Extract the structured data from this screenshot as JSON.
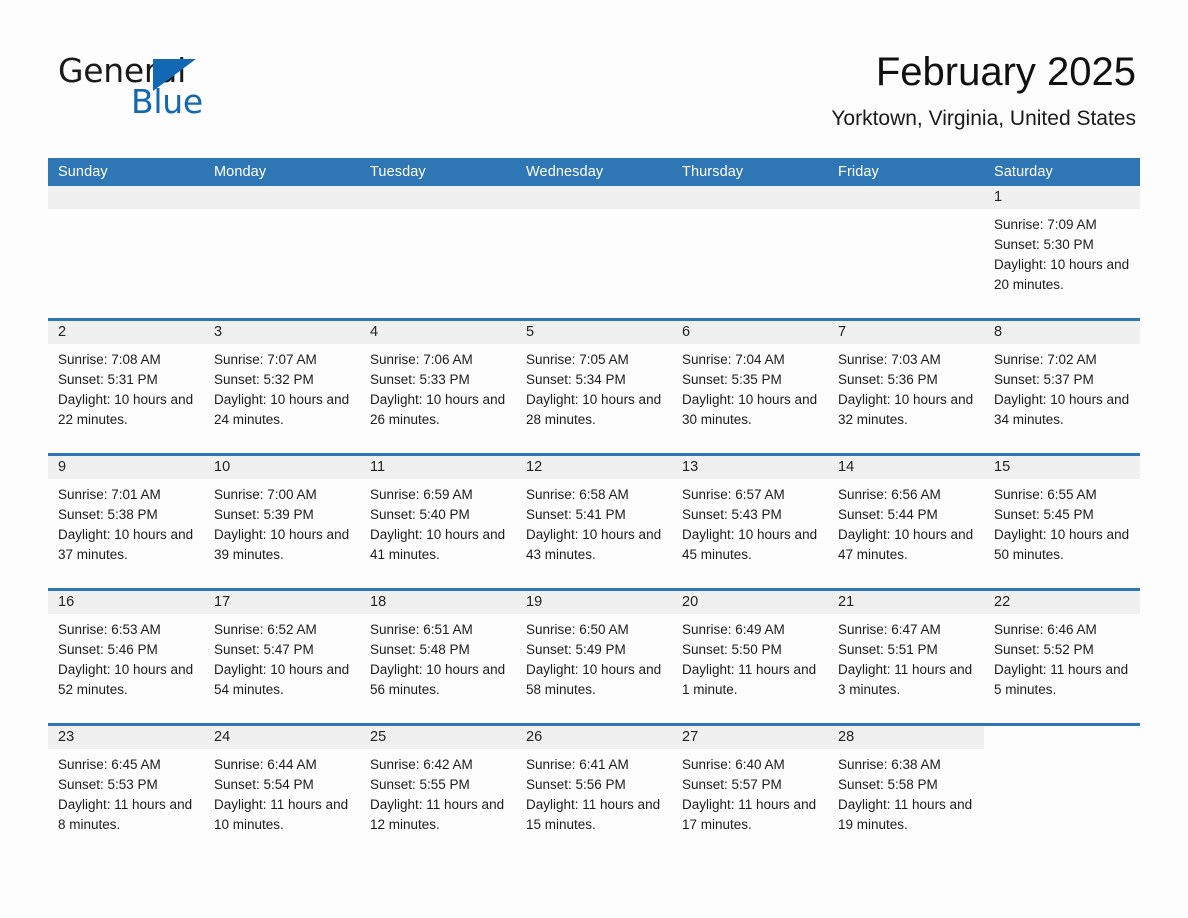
{
  "brand": {
    "name_part1": "General",
    "name_part2": "Blue",
    "accent_color": "#1268b3"
  },
  "header": {
    "title": "February 2025",
    "subtitle": "Yorktown, Virginia, United States"
  },
  "theme": {
    "header_bar_color": "#2f76b4",
    "daynum_band_color": "#f0f0f0",
    "page_background": "#fdfdfd",
    "text_color": "#1c1c1c"
  },
  "weekdays": [
    "Sunday",
    "Monday",
    "Tuesday",
    "Wednesday",
    "Thursday",
    "Friday",
    "Saturday"
  ],
  "weeks": [
    [
      {
        "blank": true
      },
      {
        "blank": true
      },
      {
        "blank": true
      },
      {
        "blank": true
      },
      {
        "blank": true
      },
      {
        "blank": true
      },
      {
        "day": "1",
        "sunrise": "Sunrise: 7:09 AM",
        "sunset": "Sunset: 5:30 PM",
        "daylight": "Daylight: 10 hours and 20 minutes."
      }
    ],
    [
      {
        "day": "2",
        "sunrise": "Sunrise: 7:08 AM",
        "sunset": "Sunset: 5:31 PM",
        "daylight": "Daylight: 10 hours and 22 minutes."
      },
      {
        "day": "3",
        "sunrise": "Sunrise: 7:07 AM",
        "sunset": "Sunset: 5:32 PM",
        "daylight": "Daylight: 10 hours and 24 minutes."
      },
      {
        "day": "4",
        "sunrise": "Sunrise: 7:06 AM",
        "sunset": "Sunset: 5:33 PM",
        "daylight": "Daylight: 10 hours and 26 minutes."
      },
      {
        "day": "5",
        "sunrise": "Sunrise: 7:05 AM",
        "sunset": "Sunset: 5:34 PM",
        "daylight": "Daylight: 10 hours and 28 minutes."
      },
      {
        "day": "6",
        "sunrise": "Sunrise: 7:04 AM",
        "sunset": "Sunset: 5:35 PM",
        "daylight": "Daylight: 10 hours and 30 minutes."
      },
      {
        "day": "7",
        "sunrise": "Sunrise: 7:03 AM",
        "sunset": "Sunset: 5:36 PM",
        "daylight": "Daylight: 10 hours and 32 minutes."
      },
      {
        "day": "8",
        "sunrise": "Sunrise: 7:02 AM",
        "sunset": "Sunset: 5:37 PM",
        "daylight": "Daylight: 10 hours and 34 minutes."
      }
    ],
    [
      {
        "day": "9",
        "sunrise": "Sunrise: 7:01 AM",
        "sunset": "Sunset: 5:38 PM",
        "daylight": "Daylight: 10 hours and 37 minutes."
      },
      {
        "day": "10",
        "sunrise": "Sunrise: 7:00 AM",
        "sunset": "Sunset: 5:39 PM",
        "daylight": "Daylight: 10 hours and 39 minutes."
      },
      {
        "day": "11",
        "sunrise": "Sunrise: 6:59 AM",
        "sunset": "Sunset: 5:40 PM",
        "daylight": "Daylight: 10 hours and 41 minutes."
      },
      {
        "day": "12",
        "sunrise": "Sunrise: 6:58 AM",
        "sunset": "Sunset: 5:41 PM",
        "daylight": "Daylight: 10 hours and 43 minutes."
      },
      {
        "day": "13",
        "sunrise": "Sunrise: 6:57 AM",
        "sunset": "Sunset: 5:43 PM",
        "daylight": "Daylight: 10 hours and 45 minutes."
      },
      {
        "day": "14",
        "sunrise": "Sunrise: 6:56 AM",
        "sunset": "Sunset: 5:44 PM",
        "daylight": "Daylight: 10 hours and 47 minutes."
      },
      {
        "day": "15",
        "sunrise": "Sunrise: 6:55 AM",
        "sunset": "Sunset: 5:45 PM",
        "daylight": "Daylight: 10 hours and 50 minutes."
      }
    ],
    [
      {
        "day": "16",
        "sunrise": "Sunrise: 6:53 AM",
        "sunset": "Sunset: 5:46 PM",
        "daylight": "Daylight: 10 hours and 52 minutes."
      },
      {
        "day": "17",
        "sunrise": "Sunrise: 6:52 AM",
        "sunset": "Sunset: 5:47 PM",
        "daylight": "Daylight: 10 hours and 54 minutes."
      },
      {
        "day": "18",
        "sunrise": "Sunrise: 6:51 AM",
        "sunset": "Sunset: 5:48 PM",
        "daylight": "Daylight: 10 hours and 56 minutes."
      },
      {
        "day": "19",
        "sunrise": "Sunrise: 6:50 AM",
        "sunset": "Sunset: 5:49 PM",
        "daylight": "Daylight: 10 hours and 58 minutes."
      },
      {
        "day": "20",
        "sunrise": "Sunrise: 6:49 AM",
        "sunset": "Sunset: 5:50 PM",
        "daylight": "Daylight: 11 hours and 1 minute."
      },
      {
        "day": "21",
        "sunrise": "Sunrise: 6:47 AM",
        "sunset": "Sunset: 5:51 PM",
        "daylight": "Daylight: 11 hours and 3 minutes."
      },
      {
        "day": "22",
        "sunrise": "Sunrise: 6:46 AM",
        "sunset": "Sunset: 5:52 PM",
        "daylight": "Daylight: 11 hours and 5 minutes."
      }
    ],
    [
      {
        "day": "23",
        "sunrise": "Sunrise: 6:45 AM",
        "sunset": "Sunset: 5:53 PM",
        "daylight": "Daylight: 11 hours and 8 minutes."
      },
      {
        "day": "24",
        "sunrise": "Sunrise: 6:44 AM",
        "sunset": "Sunset: 5:54 PM",
        "daylight": "Daylight: 11 hours and 10 minutes."
      },
      {
        "day": "25",
        "sunrise": "Sunrise: 6:42 AM",
        "sunset": "Sunset: 5:55 PM",
        "daylight": "Daylight: 11 hours and 12 minutes."
      },
      {
        "day": "26",
        "sunrise": "Sunrise: 6:41 AM",
        "sunset": "Sunset: 5:56 PM",
        "daylight": "Daylight: 11 hours and 15 minutes."
      },
      {
        "day": "27",
        "sunrise": "Sunrise: 6:40 AM",
        "sunset": "Sunset: 5:57 PM",
        "daylight": "Daylight: 11 hours and 17 minutes."
      },
      {
        "day": "28",
        "sunrise": "Sunrise: 6:38 AM",
        "sunset": "Sunset: 5:58 PM",
        "daylight": "Daylight: 11 hours and 19 minutes."
      },
      {
        "blank_noband": true
      }
    ]
  ]
}
